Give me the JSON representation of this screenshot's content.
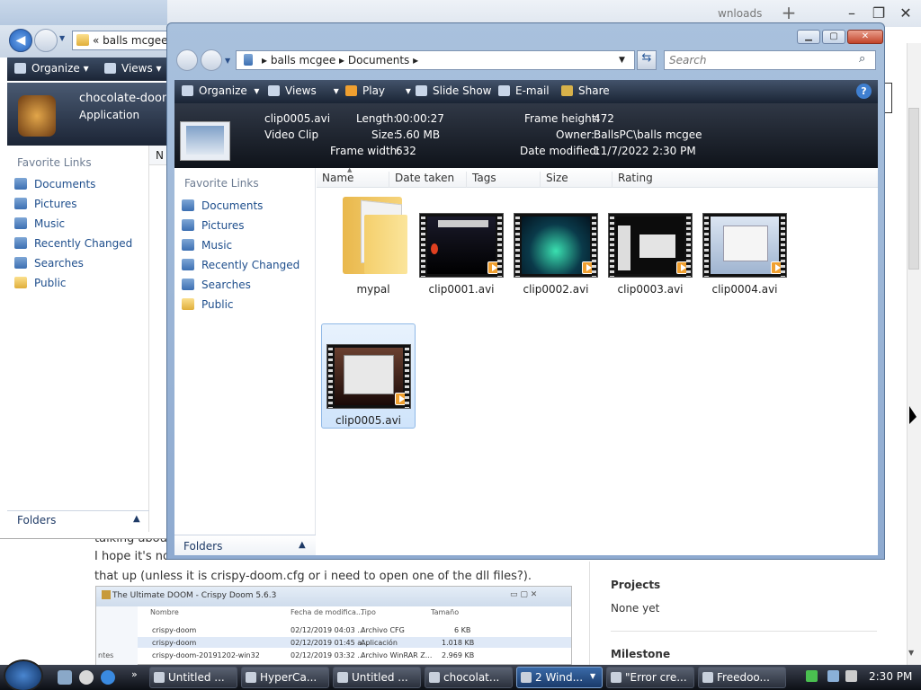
{
  "browser": {
    "tab_partial": "wnloads",
    "text": {
      "line1": "talking about",
      "line2": "I hope it's no",
      "line3": "that up (unless it is crispy-doom.cfg or i need to open one of the dll files?)."
    },
    "sidebar": {
      "projects_label": "Projects",
      "projects_value": "None yet",
      "milestone_label": "Milestone"
    },
    "embedded_screenshot": {
      "title": "The Ultimate DOOM - Crispy Doom 5.6.3",
      "headers": [
        "Nombre",
        "Fecha de modifica...",
        "Tipo",
        "Tamaño"
      ],
      "rows": [
        [
          "crispy-doom",
          "02/12/2019 04:03 ...",
          "Archivo CFG",
          "6 KB"
        ],
        [
          "crispy-doom",
          "02/12/2019 01:45 a...",
          "Aplicación",
          "1.018 KB"
        ],
        [
          "crispy-doom-20191202-win32",
          "02/12/2019 03:32 ...",
          "Archivo WinRAR Z...",
          "2.969 KB"
        ]
      ],
      "side_partial": "ntes"
    }
  },
  "back_explorer": {
    "address_prefix": "«",
    "address": "balls mcgee",
    "toolbar": {
      "organize": "Organize",
      "views": "Views"
    },
    "detail": {
      "name": "chocolate-doom",
      "type": "Application"
    },
    "col_partial": "N",
    "favorite_links_title": "Favorite Links",
    "links": [
      "Documents",
      "Pictures",
      "Music",
      "Recently Changed",
      "Searches",
      "Public"
    ],
    "folders_label": "Folders"
  },
  "explorer": {
    "breadcrumb": [
      "balls mcgee",
      "Documents"
    ],
    "search_placeholder": "Search",
    "toolbar": {
      "organize": "Organize",
      "views": "Views",
      "play": "Play",
      "slideshow": "Slide Show",
      "email": "E-mail",
      "share": "Share"
    },
    "details": {
      "name": "clip0005.avi",
      "type": "Video Clip",
      "length_label": "Length:",
      "length": "00:00:27",
      "size_label": "Size:",
      "size": "5.60 MB",
      "frame_width_label": "Frame width:",
      "frame_width": "632",
      "frame_height_label": "Frame height:",
      "frame_height": "472",
      "owner_label": "Owner:",
      "owner": "BallsPC\\balls mcgee",
      "date_modified_label": "Date modified:",
      "date_modified": "11/7/2022 2:30 PM"
    },
    "favorite_links_title": "Favorite Links",
    "links": [
      "Documents",
      "Pictures",
      "Music",
      "Recently Changed",
      "Searches",
      "Public"
    ],
    "columns": [
      "Name",
      "Date taken",
      "Tags",
      "Size",
      "Rating"
    ],
    "items": [
      "mypal",
      "clip0001.avi",
      "clip0002.avi",
      "clip0003.avi",
      "clip0004.avi",
      "clip0005.avi"
    ],
    "folders_label": "Folders"
  },
  "taskbar": {
    "buttons": [
      "Untitled ...",
      "HyperCa...",
      "Untitled ...",
      "chocolat...",
      "2 Wind...",
      "\"Error cre...",
      "Freedoo..."
    ],
    "clock": "2:30 PM"
  }
}
